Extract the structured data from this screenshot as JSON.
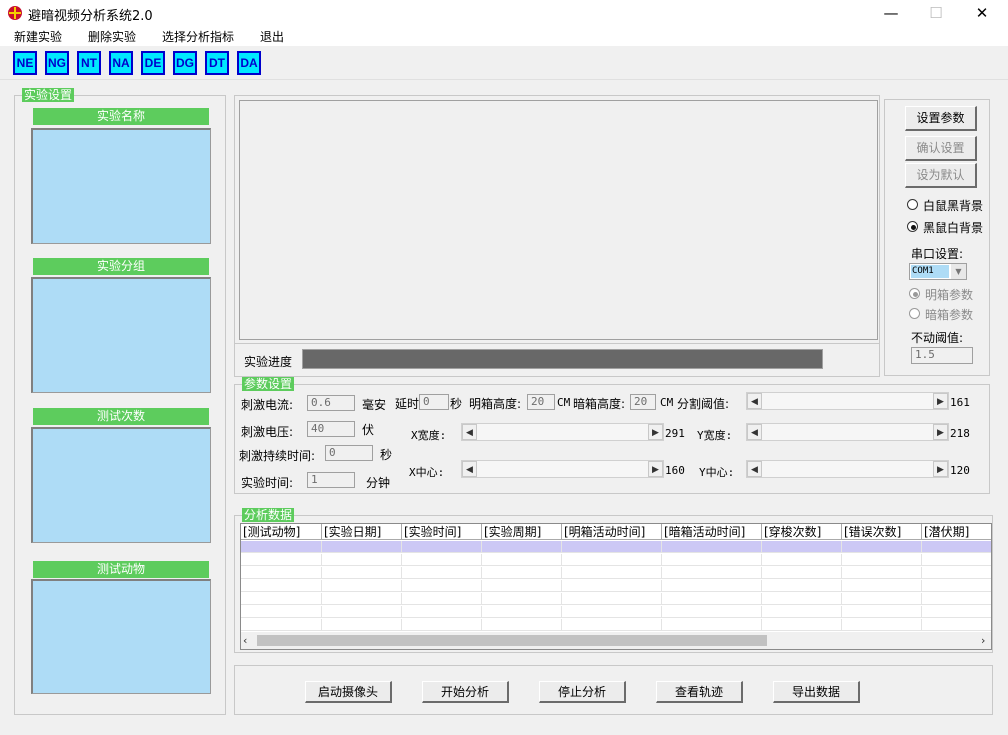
{
  "window": {
    "title": "避暗视频分析系统2.0",
    "min": "—",
    "max": "☐",
    "close": "✕"
  },
  "menu": [
    "新建实验",
    "删除实验",
    "选择分析指标",
    "退出"
  ],
  "toolbar": [
    "NE",
    "NG",
    "NT",
    "NA",
    "DE",
    "DG",
    "DT",
    "DA"
  ],
  "experiment_settings": {
    "title": "实验设置",
    "lists": [
      "实验名称",
      "实验分组",
      "测试次数",
      "测试动物"
    ]
  },
  "right_panel": {
    "buttons": [
      "设置参数",
      "确认设置",
      "设为默认"
    ],
    "radios": [
      "白鼠黑背景",
      "黑鼠白背景"
    ],
    "serial_label": "串口设置:",
    "serial_value": "COM1",
    "box_radios": [
      "明箱参数",
      "暗箱参数"
    ],
    "threshold_label": "不动阈值:",
    "threshold_value": "1.5"
  },
  "progress": {
    "label": "实验进度",
    "fill_fraction": 1.0
  },
  "params": {
    "title": "参数设置",
    "current_label": "刺激电流:",
    "current_value": "0.6",
    "current_unit": "毫安",
    "delay_label": "延时",
    "delay_value": "0",
    "delay_unit": "秒",
    "light_h_label": "明箱高度:",
    "light_h_value": "20",
    "light_h_unit": "CM",
    "dark_h_label": "暗箱高度:",
    "dark_h_value": "20",
    "dark_h_unit": "CM",
    "seg_label": "分割阈值:",
    "seg_value": "161",
    "voltage_label": "刺激电压:",
    "voltage_value": "40",
    "voltage_unit": "伏",
    "xwidth_label": "X宽度:",
    "xwidth_value": "291",
    "ywidth_label": "Y宽度:",
    "ywidth_value": "218",
    "duration_label": "刺激持续时间:",
    "duration_value": "0",
    "duration_unit": "秒",
    "exptime_label": "实验时间:",
    "exptime_value": "1",
    "exptime_unit": "分钟",
    "xcenter_label": "X中心:",
    "xcenter_value": "160",
    "ycenter_label": "Y中心:",
    "ycenter_value": "120"
  },
  "analysis": {
    "title": "分析数据",
    "columns": [
      "[测试动物]",
      "[实验日期]",
      "[实验时间]",
      "[实验周期]",
      "[明箱活动时间]",
      "[暗箱活动时间]",
      "[穿梭次数]",
      "[错误次数]",
      "[潜伏期]"
    ]
  },
  "actions": [
    "启动摄像头",
    "开始分析",
    "停止分析",
    "查看轨迹",
    "导出数据"
  ]
}
